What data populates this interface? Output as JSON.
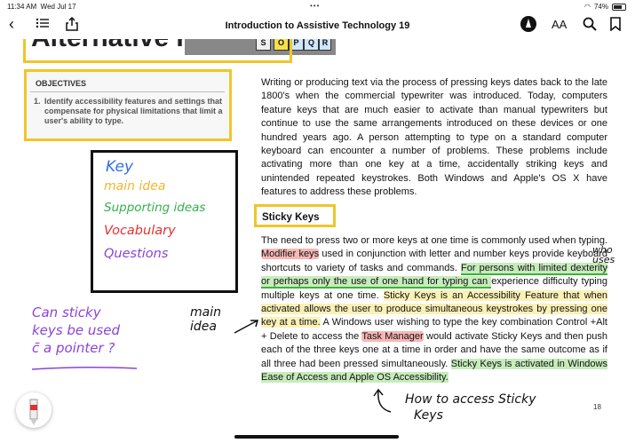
{
  "status_bar": {
    "time": "11:34 AM",
    "date": "Wed Jul 17",
    "battery": "74%",
    "battery_fraction": 0.74
  },
  "toolbar": {
    "title": "Introduction to Assistive Technology 19",
    "text_size_label": "AA"
  },
  "page": {
    "objectives": {
      "heading": "OBJECTIVES",
      "items": [
        {
          "number": "1.",
          "text": "Identify accessibility features and settings that compensate for physical limitations that limit a user's ability to type."
        }
      ]
    },
    "key_legend": {
      "items": [
        {
          "label": "Key",
          "color": "#2f6fe0"
        },
        {
          "label": "main idea",
          "color": "#f2b530"
        },
        {
          "label": "Supporting ideas",
          "color": "#33b14a"
        },
        {
          "label": "Vocabulary",
          "color": "#e33030"
        },
        {
          "label": "Questions",
          "color": "#8a44d8"
        }
      ]
    },
    "intro_paragraph": "Writing or producing text via the process of pressing keys dates back to the late 1800's when the commercial typewriter was introduced. Today, computers feature keys that are much easier to activate than manual typewriters but continue to use the same arrangements introduced on these devices or one hundred years ago. A person attempting to type on a standard computer keyboard can encounter a number of problems. These problems include activating more than one key at a time, accidentally striking keys and unintended repeated keystrokes. Both Windows and Apple's OS X have features to address these problems.",
    "section_heading": "Sticky Keys",
    "sticky_paragraph": {
      "t1": "The need to press two or more keys at one time is commonly used when typing. ",
      "vocab1": "Modifier keys",
      "t2": " used in conjunction with letter and number keys provide keyboard shortcuts to variety of tasks and commands. ",
      "support1": "For persons with limited dexterity or perhaps only the use of one hand for typing can ",
      "t3": "experience difficulty typing multiple keys at one time. ",
      "main_idea": "Sticky Keys is an Accessibility Feature that when activated allows the user to produce simultaneous keystrokes by pressing one key at a time.",
      "t4": " A Windows user wishing to type the key combination Control +Alt + Delete to access the ",
      "vocab2": "Task Manager",
      "t5": " would activate Sticky Keys and then push each of the three keys one at a time in order and have the same outcome as if all three had been pressed simultaneously. ",
      "support2": "Sticky Keys is activated in Windows Ease of Access and Apple OS Accessibility."
    },
    "page_number": "18",
    "keyboard_keys": [
      "O",
      "P",
      "Q",
      "R",
      "S"
    ],
    "handwriting": {
      "question": [
        "Can sticky",
        "keys be used",
        "c̄ a pointer ?"
      ],
      "main_idea_note": [
        "main",
        "idea"
      ],
      "who_uses": [
        "who",
        "uses",
        "it"
      ],
      "how_to": [
        "How to access Sticky",
        "Keys"
      ]
    },
    "heading_fragment": "Alternative Keys"
  }
}
